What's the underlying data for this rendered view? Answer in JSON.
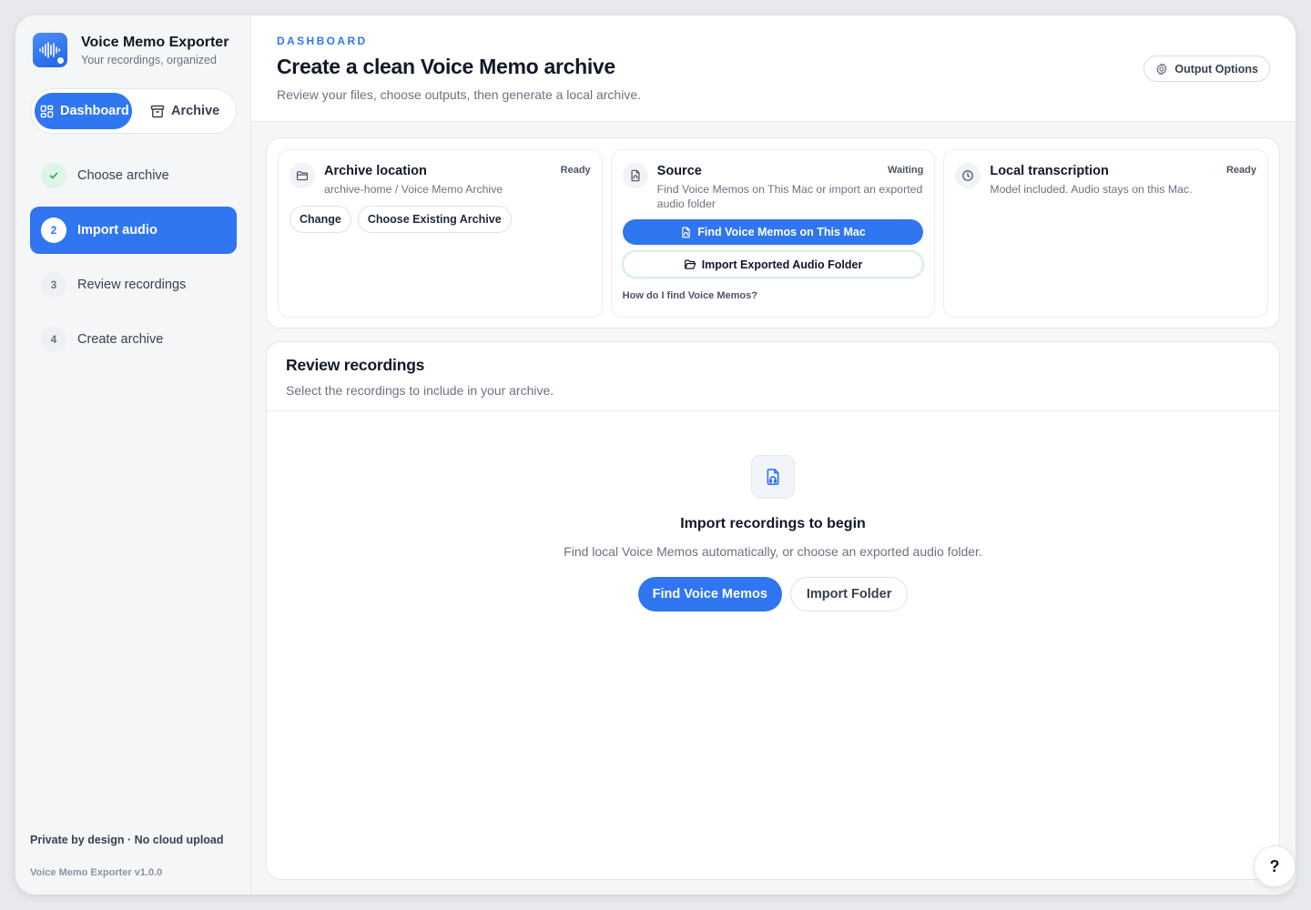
{
  "app": {
    "title": "Voice Memo Exporter",
    "subtitle": "Your recordings, organized",
    "version": "Voice Memo Exporter v1.0.0",
    "footer_note": "Private by design · No cloud upload"
  },
  "nav": {
    "tabs": [
      {
        "label": "Dashboard",
        "icon": "grid-icon",
        "active": true
      },
      {
        "label": "Archive",
        "icon": "archive-box-icon",
        "active": false
      }
    ]
  },
  "steps": [
    {
      "number": "✓",
      "label": "Choose archive",
      "state": "done"
    },
    {
      "number": "2",
      "label": "Import audio",
      "state": "active"
    },
    {
      "number": "3",
      "label": "Review recordings",
      "state": "pending"
    },
    {
      "number": "4",
      "label": "Create archive",
      "state": "pending"
    }
  ],
  "header": {
    "eyebrow": "DASHBOARD",
    "title": "Create a clean Voice Memo archive",
    "subtitle": "Review your files, choose outputs, then generate a local archive.",
    "output_options_label": "Output Options"
  },
  "cards": {
    "archive": {
      "title": "Archive location",
      "status": "Ready",
      "path": "archive-home / Voice Memo Archive",
      "change_label": "Change",
      "choose_label": "Choose Existing Archive"
    },
    "source": {
      "title": "Source",
      "status": "Waiting",
      "desc": "Find Voice Memos on This Mac or import an exported audio folder",
      "find_label": "Find Voice Memos on This Mac",
      "import_label": "Import Exported Audio Folder",
      "help_label": "How do I find Voice Memos?"
    },
    "transcription": {
      "title": "Local transcription",
      "status": "Ready",
      "desc": "Model included. Audio stays on this Mac."
    }
  },
  "review": {
    "title": "Review recordings",
    "subtitle": "Select the recordings to include in your archive.",
    "empty_title": "Import recordings to begin",
    "empty_sub": "Find local Voice Memos automatically, or choose an exported audio folder.",
    "find_label": "Find Voice Memos",
    "import_label": "Import Folder"
  },
  "help_fab": "?",
  "colors": {
    "accent": "#2f76f0",
    "success": "#22a55a"
  }
}
